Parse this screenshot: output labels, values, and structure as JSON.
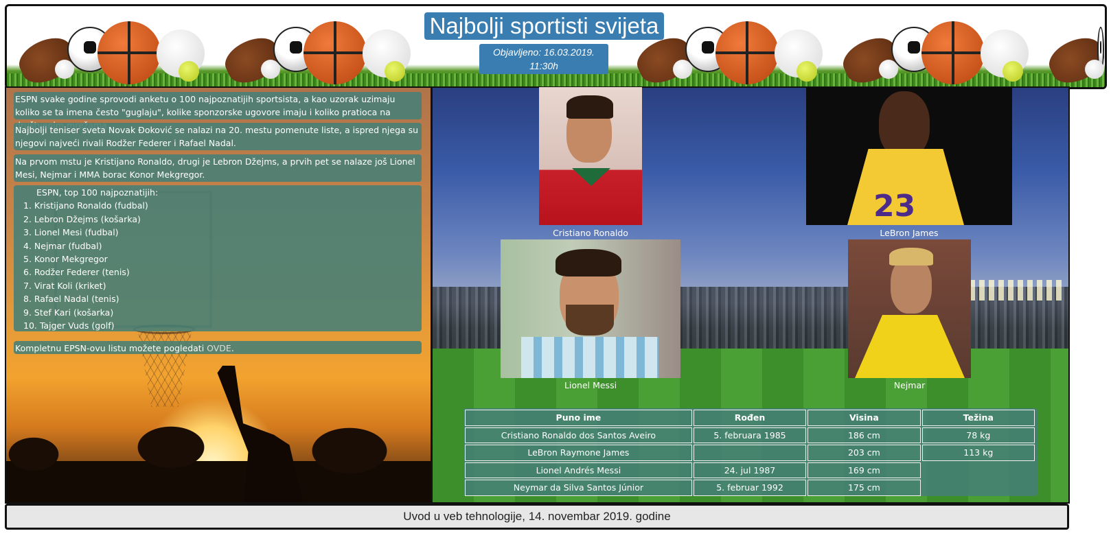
{
  "header": {
    "title": "Najbolji sportisti svijeta",
    "published_line1": "Objavljeno: 16.03.2019.",
    "published_line2": "11:30h"
  },
  "left": {
    "paragraph1": "ESPN svake godine sprovodi anketu o 100 najpoznatijih sportsista, a kao uzorak uzimaju koliko se ta imena često \"guglaju\", kolike sponzorske ugovore imaju i koliko pratioca na društvenim mrežama.",
    "paragraph2": "Najbolji teniser sveta Novak Đoković se nalazi na 20. mestu pomenute liste, a ispred njega su njegovi najveći rivali Rodžer Federer i Rafael Nadal.",
    "paragraph3": "Na prvom mstu je Kristijano Ronaldo, drugi je Lebron Džejms, a prvih pet se nalaze još Lionel Mesi, Nejmar i MMA borac Konor Mekgregor.",
    "list_title": "ESPN, top 100 najpoznatijih:",
    "top_list": [
      "1. Kristijano Ronaldo (fudbal)",
      "2. Lebron Džejms (košarka)",
      "3. Lionel Mesi (fudbal)",
      "4. Nejmar (fudbal)",
      "5. Konor Mekgregor",
      "6. Rodžer Federer (tenis)",
      "7. Virat Koli (kriket)",
      "8. Rafael Nadal (tenis)",
      "9. Stef Kari (košarka)",
      "10. Tajger Vuds (golf)"
    ],
    "full_list_text": "Kompletnu EPSN-ovu listu možete pogledati ",
    "full_list_link": "OVDE",
    "full_list_end": "."
  },
  "photos": {
    "ronaldo": "Cristiano Ronaldo",
    "lebron": "LeBron James",
    "messi": "Lionel Messi",
    "neymar": "Nejmar"
  },
  "table": {
    "headers": [
      "Puno ime",
      "Rođen",
      "Visina",
      "Težina"
    ],
    "rows": [
      [
        "Cristiano Ronaldo dos Santos Aveiro",
        "5. februara 1985",
        "186 cm",
        "78 kg"
      ],
      [
        "LeBron Raymone James",
        "",
        "203 cm",
        "113 kg"
      ],
      [
        "Lionel Andrés Messi",
        "24. jul 1987",
        "169 cm",
        ""
      ],
      [
        "Neymar da Silva Santos Júnior",
        "5. februar 1992",
        "175 cm",
        ""
      ]
    ]
  },
  "footer": {
    "text": "Uvod u veb tehnologije, 14. novembar 2019. godine"
  }
}
